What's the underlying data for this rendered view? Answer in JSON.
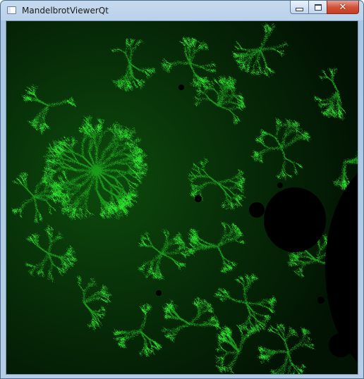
{
  "window": {
    "title": "MandelbrotViewerQt",
    "controls": {
      "minimize_icon": "minimize-icon",
      "maximize_icon": "maximize-icon",
      "close_icon": "close-icon",
      "close_glyph": "✕"
    }
  },
  "colors": {
    "background": "#021a04",
    "fractal_bright": "#2fe12f",
    "fractal_mid": "#1a9a1a",
    "set_interior": "#000000"
  }
}
